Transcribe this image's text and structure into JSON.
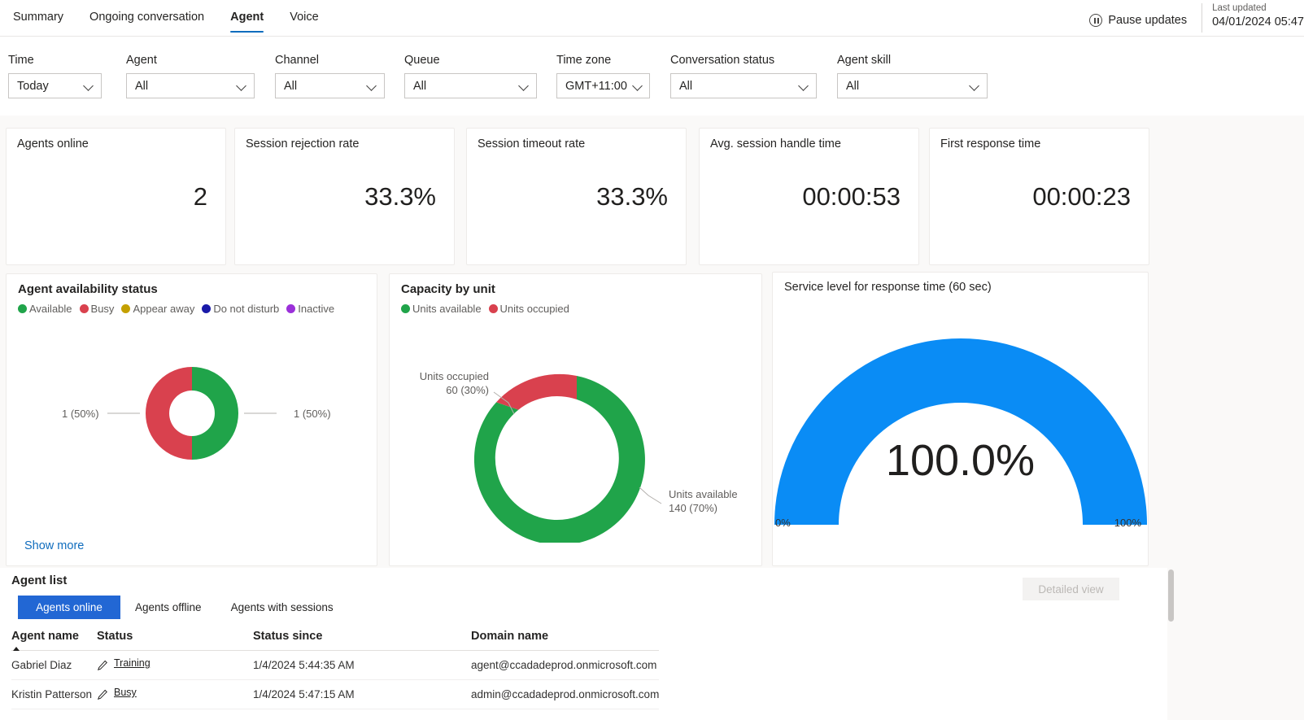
{
  "tabs": [
    {
      "label": "Summary",
      "active": false
    },
    {
      "label": "Ongoing conversation",
      "active": false
    },
    {
      "label": "Agent",
      "active": true
    },
    {
      "label": "Voice",
      "active": false
    }
  ],
  "header": {
    "pause_label": "Pause updates",
    "last_updated_label": "Last updated",
    "last_updated_value": "04/01/2024 05:47"
  },
  "filters": [
    {
      "label": "Time",
      "value": "Today"
    },
    {
      "label": "Agent",
      "value": "All"
    },
    {
      "label": "Channel",
      "value": "All"
    },
    {
      "label": "Queue",
      "value": "All"
    },
    {
      "label": "Time zone",
      "value": "GMT+11:00"
    },
    {
      "label": "Conversation status",
      "value": "All"
    },
    {
      "label": "Agent skill",
      "value": "All"
    }
  ],
  "kpis": [
    {
      "title": "Agents online",
      "value": "2"
    },
    {
      "title": "Session rejection rate",
      "value": "33.3%"
    },
    {
      "title": "Session timeout rate",
      "value": "33.3%"
    },
    {
      "title": "Avg. session handle time",
      "value": "00:00:53"
    },
    {
      "title": "First response time",
      "value": "00:00:23"
    }
  ],
  "availability": {
    "title": "Agent availability status",
    "legend": [
      {
        "label": "Available",
        "color": "#20a44a"
      },
      {
        "label": "Busy",
        "color": "#d9414e"
      },
      {
        "label": "Appear away",
        "color": "#c4a000"
      },
      {
        "label": "Do not disturb",
        "color": "#1a1aa8"
      },
      {
        "label": "Inactive",
        "color": "#9b30d9"
      }
    ],
    "left_label": "1 (50%)",
    "right_label": "1 (50%)",
    "show_more": "Show more"
  },
  "capacity": {
    "title": "Capacity by unit",
    "legend": [
      {
        "label": "Units available",
        "color": "#20a44a"
      },
      {
        "label": "Units occupied",
        "color": "#d9414e"
      }
    ],
    "occupied_label_1": "Units occupied",
    "occupied_label_2": "60 (30%)",
    "available_label_1": "Units available",
    "available_label_2": "140 (70%)"
  },
  "service_level": {
    "title": "Service level for response time (60 sec)",
    "value": "100.0%",
    "min_label": "0%",
    "max_label": "100%",
    "color": "#0a8cf5"
  },
  "agent_list": {
    "title": "Agent list",
    "pivots": [
      {
        "label": "Agents online",
        "active": true
      },
      {
        "label": "Agents offline",
        "active": false
      },
      {
        "label": "Agents with sessions",
        "active": false
      }
    ],
    "detailed_view": "Detailed view",
    "columns": [
      "Agent name",
      "Status",
      "Status since",
      "Domain name"
    ],
    "rows": [
      {
        "agent_name": "Gabriel Diaz",
        "status": "Training",
        "status_since": "1/4/2024 5:44:35 AM",
        "domain_name": "agent@ccadadeprod.onmicrosoft.com"
      },
      {
        "agent_name": "Kristin Patterson",
        "status": "Busy",
        "status_since": "1/4/2024 5:47:15 AM",
        "domain_name": "admin@ccadadeprod.onmicrosoft.com"
      }
    ]
  },
  "chart_data": [
    {
      "type": "pie",
      "title": "Agent availability status",
      "categories": [
        "Available",
        "Busy",
        "Appear away",
        "Do not disturb",
        "Inactive"
      ],
      "values": [
        1,
        1,
        0,
        0,
        0
      ],
      "percentages": [
        50,
        50,
        0,
        0,
        0
      ],
      "labels": [
        "1 (50%)",
        "1 (50%)"
      ],
      "colors": [
        "#20a44a",
        "#d9414e",
        "#c4a000",
        "#1a1aa8",
        "#9b30d9"
      ],
      "legend_position": "top"
    },
    {
      "type": "pie",
      "title": "Capacity by unit",
      "categories": [
        "Units available",
        "Units occupied"
      ],
      "values": [
        140,
        60
      ],
      "percentages": [
        70,
        30
      ],
      "labels": [
        "140 (70%)",
        "60 (30%)"
      ],
      "colors": [
        "#20a44a",
        "#d9414e"
      ],
      "legend_position": "top"
    },
    {
      "type": "bar",
      "title": "Service level for response time (60 sec)",
      "categories": [
        "Service level"
      ],
      "values": [
        100.0
      ],
      "ylim": [
        0,
        100
      ],
      "xlabel": "",
      "ylabel": "",
      "tick_labels": [
        "0%",
        "100%"
      ],
      "annotation": "100.0%"
    }
  ]
}
